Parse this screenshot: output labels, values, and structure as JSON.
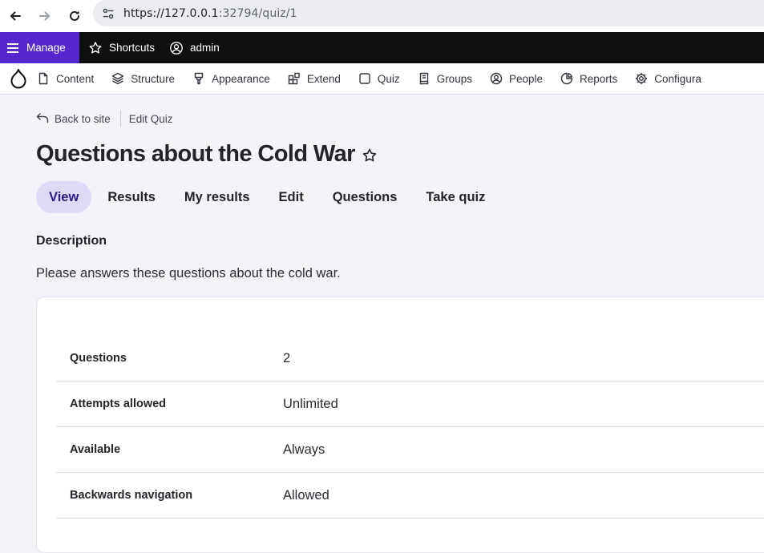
{
  "browser": {
    "url_host": "https://127.0.0.1",
    "url_rest": ":32794/quiz/1"
  },
  "toolbar": {
    "manage_label": "Manage",
    "shortcuts_label": "Shortcuts",
    "user_label": "admin",
    "accent_color": "#5528cf"
  },
  "admin_menu": {
    "items": [
      {
        "label": "Content",
        "icon": "file-icon"
      },
      {
        "label": "Structure",
        "icon": "layers-icon"
      },
      {
        "label": "Appearance",
        "icon": "brush-icon"
      },
      {
        "label": "Extend",
        "icon": "puzzle-icon"
      },
      {
        "label": "Quiz",
        "icon": "square-icon"
      },
      {
        "label": "Groups",
        "icon": "book-icon"
      },
      {
        "label": "People",
        "icon": "user-icon"
      },
      {
        "label": "Reports",
        "icon": "pie-chart-icon"
      },
      {
        "label": "Configura",
        "icon": "gear-icon"
      }
    ]
  },
  "breadcrumb": {
    "back_label": "Back to site",
    "current_label": "Edit Quiz"
  },
  "page": {
    "title": "Questions about the Cold War"
  },
  "tabs": [
    {
      "label": "View",
      "active": true
    },
    {
      "label": "Results",
      "active": false
    },
    {
      "label": "My results",
      "active": false
    },
    {
      "label": "Edit",
      "active": false
    },
    {
      "label": "Questions",
      "active": false
    },
    {
      "label": "Take quiz",
      "active": false
    }
  ],
  "description": {
    "label": "Description",
    "text": "Please answers these questions about the cold war."
  },
  "info_rows": [
    {
      "label": "Questions",
      "value": "2"
    },
    {
      "label": "Attempts allowed",
      "value": "Unlimited"
    },
    {
      "label": "Available",
      "value": "Always"
    },
    {
      "label": "Backwards navigation",
      "value": "Allowed"
    }
  ]
}
